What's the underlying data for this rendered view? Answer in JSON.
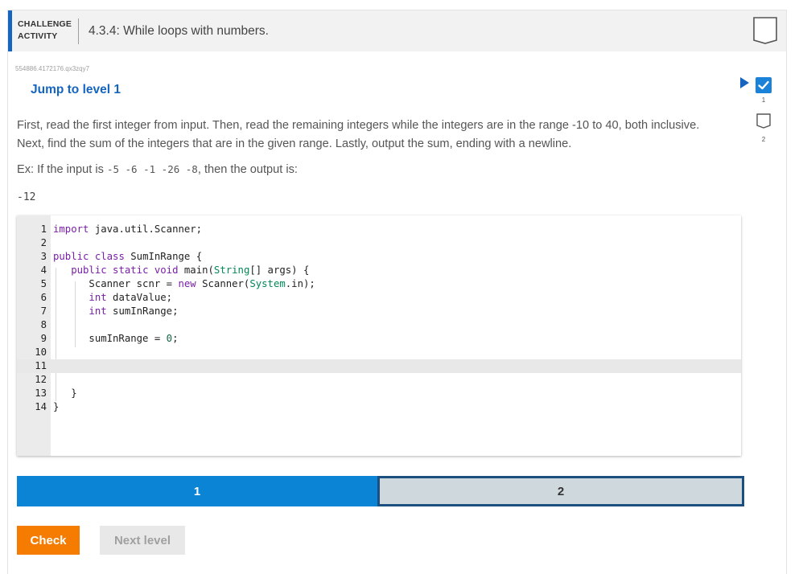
{
  "header": {
    "badge_line1": "CHALLENGE",
    "badge_line2": "ACTIVITY",
    "title": "4.3.4: While loops with numbers.",
    "accent": "#1565c0"
  },
  "activity_id": "554886.4172176.qx3zqy7",
  "jump_label": "Jump to level 1",
  "instructions": "First, read the first integer from input. Then, read the remaining integers while the integers are in the range -10 to 40, both inclusive. Next, find the sum of the integers that are in the given range. Lastly, output the sum, ending with a newline.",
  "example": {
    "prefix": "Ex: If the input is ",
    "input": "-5 -6 -1 -26 -8",
    "suffix": ", then the output is:",
    "output": "-12"
  },
  "code_lines": [
    {
      "n": "1",
      "text": "import java.util.Scanner;"
    },
    {
      "n": "2",
      "text": ""
    },
    {
      "n": "3",
      "text": "public class SumInRange {"
    },
    {
      "n": "4",
      "text": "   public static void main(String[] args) {"
    },
    {
      "n": "5",
      "text": "      Scanner scnr = new Scanner(System.in);"
    },
    {
      "n": "6",
      "text": "      int dataValue;"
    },
    {
      "n": "7",
      "text": "      int sumInRange;"
    },
    {
      "n": "8",
      "text": ""
    },
    {
      "n": "9",
      "text": "      sumInRange = 0;"
    },
    {
      "n": "10",
      "text": ""
    },
    {
      "n": "11",
      "text": ""
    },
    {
      "n": "12",
      "text": ""
    },
    {
      "n": "13",
      "text": "   }"
    },
    {
      "n": "14",
      "text": "}"
    }
  ],
  "levels": [
    {
      "label": "1",
      "active": true
    },
    {
      "label": "2",
      "active": false
    }
  ],
  "buttons": {
    "check": "Check",
    "next": "Next level"
  },
  "level_sidebar": [
    {
      "label": "1",
      "done": true
    },
    {
      "label": "2",
      "done": false
    }
  ],
  "colors": {
    "active_level": "#0b84d5",
    "inactive_level": "#cfd8dc",
    "check_button": "#f57c00"
  }
}
